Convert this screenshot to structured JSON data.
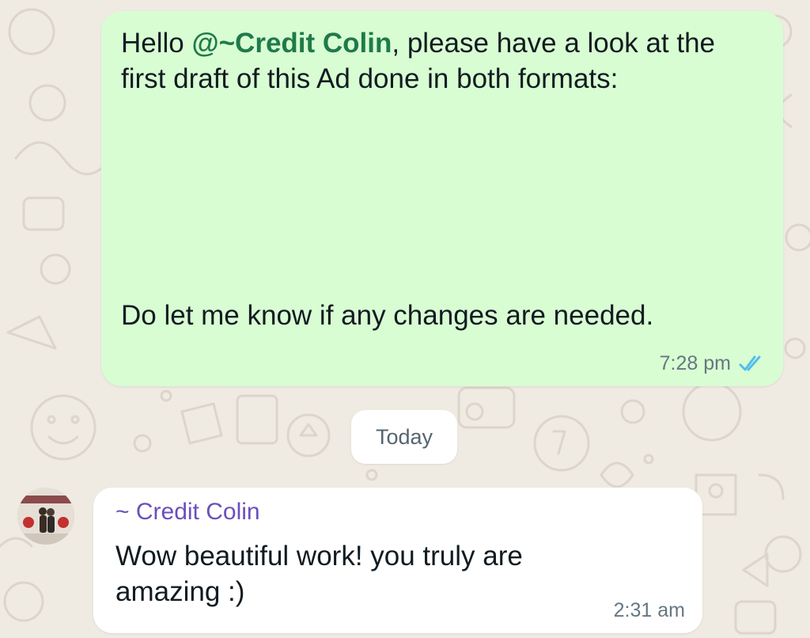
{
  "outgoing_message": {
    "greeting": "Hello ",
    "mention": "@~Credit Colin",
    "text_after_mention": ", please have a look at the first draft of this Ad done in both formats:",
    "closing": "Do let me know if any changes are needed.",
    "time": "7:28 pm",
    "status_icon": "double-check-read-icon"
  },
  "date_separator": {
    "label": "Today"
  },
  "incoming_message": {
    "sender": "~ Credit Colin",
    "text": "Wow beautiful work! you truly are amazing :)",
    "time": "2:31 am",
    "avatar_icon": "avatar"
  },
  "colors": {
    "chat_background": "#efeae2",
    "outgoing_bubble": "#d9fdd3",
    "incoming_bubble": "#ffffff",
    "mention": "#1f7a4a",
    "sender_name": "#6b4fbb",
    "read_ticks": "#53bdeb",
    "timestamp": "#667781"
  }
}
